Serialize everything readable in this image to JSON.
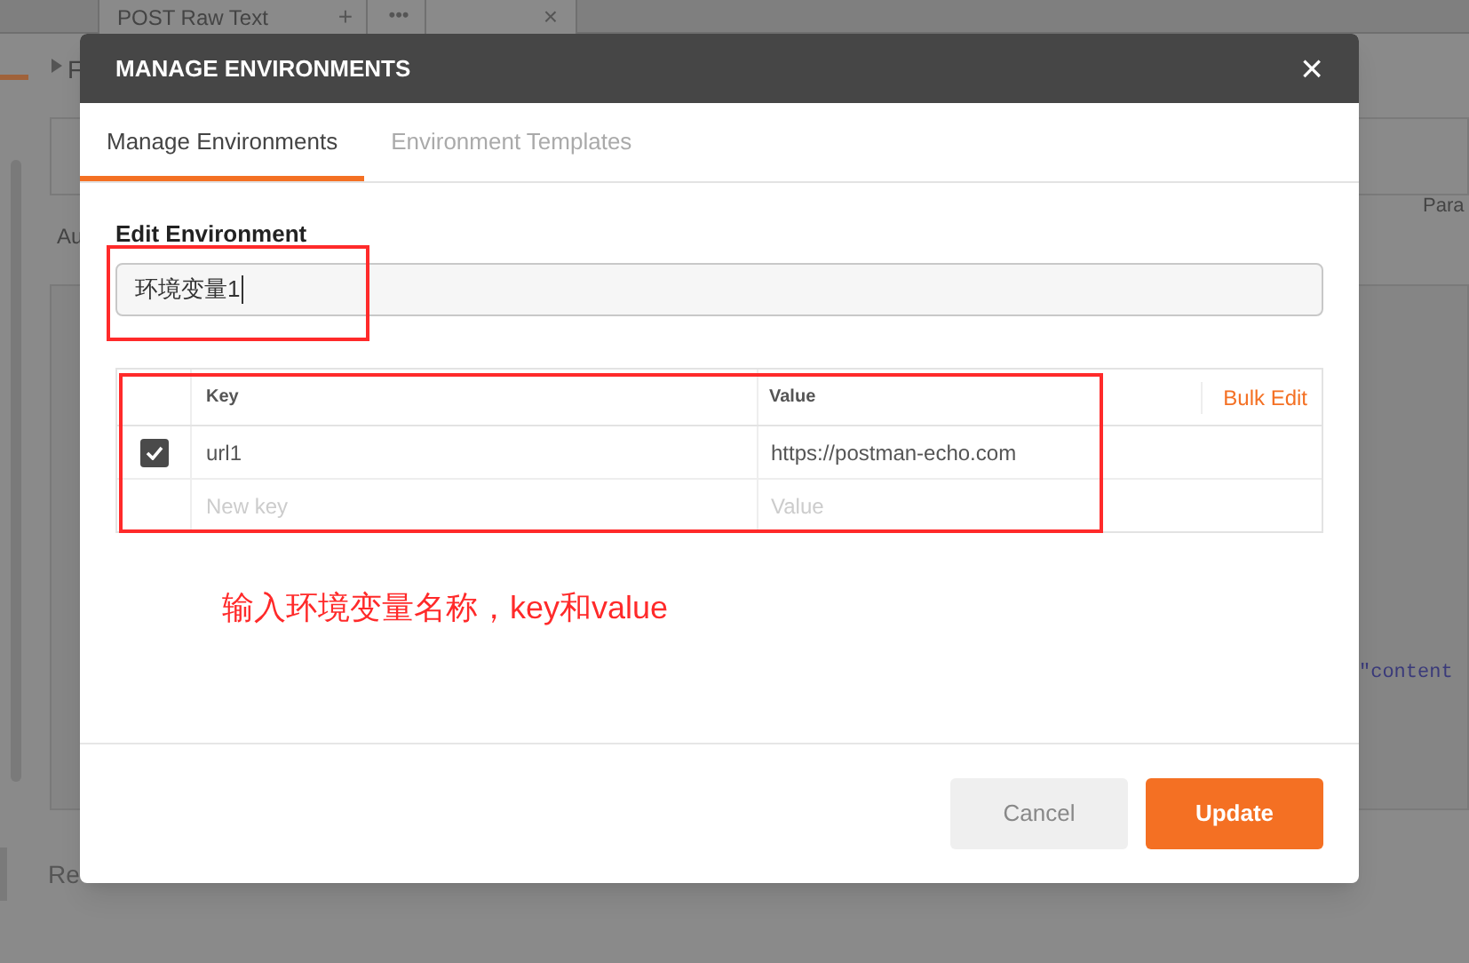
{
  "background": {
    "tab_label": "POST Raw Text",
    "tab_close": "×",
    "add_tab": "+",
    "more_tabs": "•••",
    "section_label": "F",
    "side_tab": "Para",
    "auth_label": "Au",
    "response_label": "Re",
    "code_fragment": "\"content"
  },
  "dialog": {
    "title": "MANAGE ENVIRONMENTS",
    "close": "×",
    "tabs": [
      {
        "label": "Manage Environments",
        "selected": true
      },
      {
        "label": "Environment Templates",
        "selected": false
      }
    ],
    "name_label": "Edit Environment",
    "name_value": "环境变量1",
    "table": {
      "columns": [
        "Key",
        "Value"
      ],
      "bulk_edit": "Bulk Edit",
      "rows": [
        {
          "checked": true,
          "key": "url1",
          "value": "https://postman-echo.com"
        }
      ],
      "new_row": {
        "key_placeholder": "New key",
        "value_placeholder": "Value"
      }
    },
    "buttons": [
      {
        "label": "Cancel",
        "kind": "secondary"
      },
      {
        "label": "Update",
        "kind": "primary"
      }
    ]
  },
  "annotation": {
    "text": "输入环境变量名称，key和value"
  }
}
